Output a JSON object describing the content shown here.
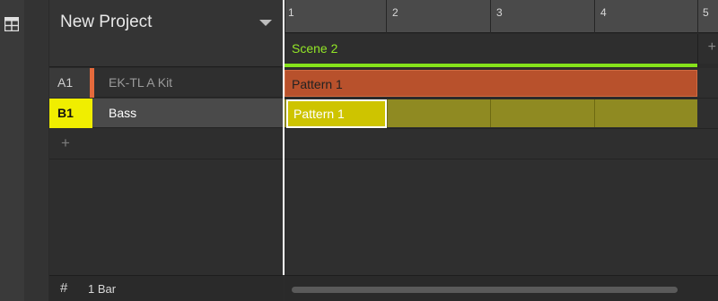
{
  "project": {
    "title": "New Project"
  },
  "groups": [
    {
      "id": "A1",
      "name": "EK-TL A Kit",
      "color": "#e56a3c"
    },
    {
      "id": "B1",
      "name": "Bass",
      "color": "#f0ee00"
    }
  ],
  "add_group_label": "+",
  "footer": {
    "hash_label": "#",
    "length": "1 Bar"
  },
  "ruler": {
    "bars": [
      "1",
      "2",
      "3",
      "4",
      "5"
    ]
  },
  "scene": {
    "name": "Scene 2",
    "add_label": "+",
    "color": "#86e31a"
  },
  "patterns": {
    "a1": "Pattern 1",
    "b1": "Pattern 1"
  }
}
